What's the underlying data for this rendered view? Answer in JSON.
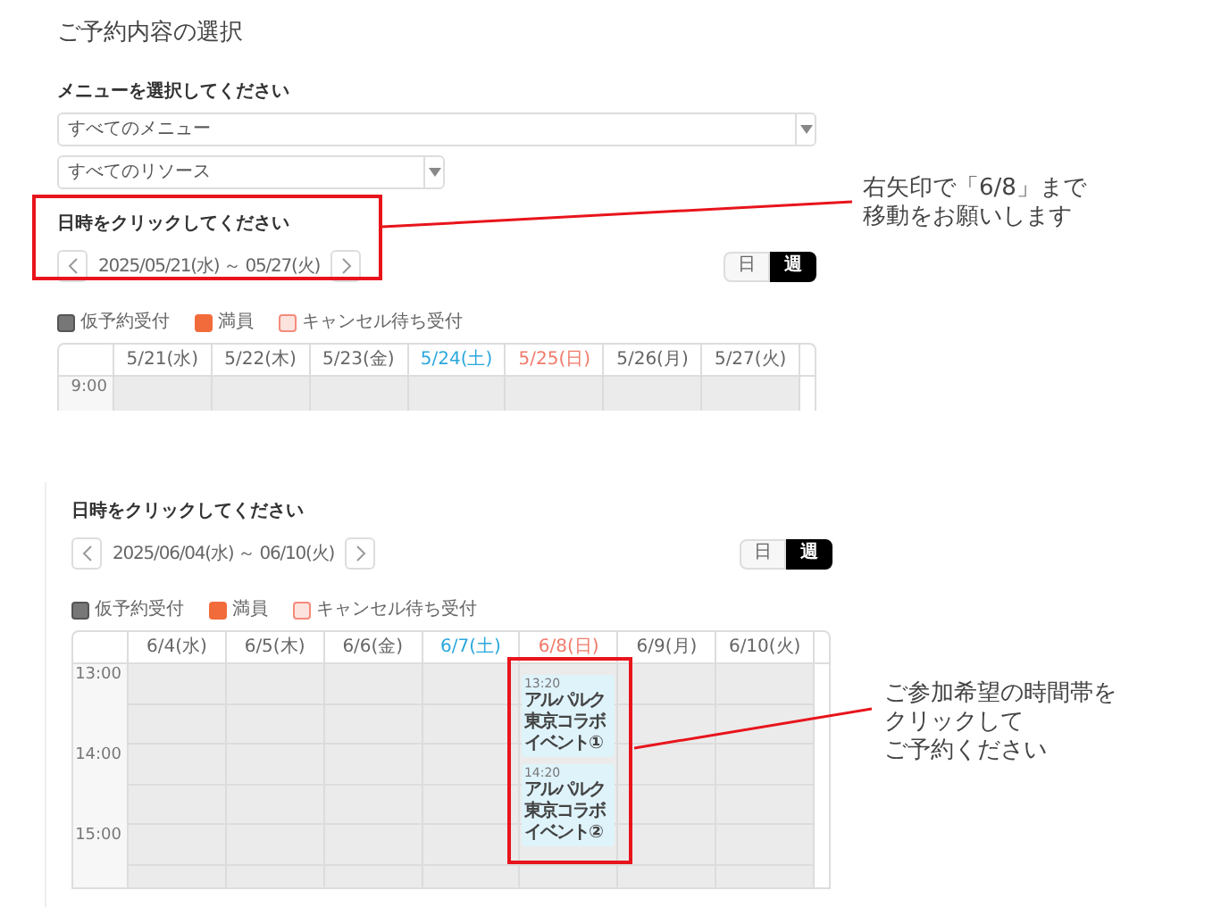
{
  "title": "ご予約内容の選択",
  "menu_select": {
    "label": "メニューを選択してください",
    "value": "すべてのメニュー"
  },
  "resource_select": {
    "value": "すべてのリソース"
  },
  "panels": [
    {
      "label": "日時をクリックしてください",
      "date_range": "2025/05/21(水) ～ 05/27(火)",
      "view_toggle": [
        {
          "label": "日",
          "selected": false
        },
        {
          "label": "週",
          "selected": true
        }
      ],
      "legend": [
        {
          "kind": "tentative",
          "label": "仮予約受付"
        },
        {
          "kind": "full",
          "label": "満員"
        },
        {
          "kind": "waitlist",
          "label": "キャンセル待ち受付"
        }
      ],
      "days": [
        {
          "label": "5/21(水)",
          "kind": "weekday"
        },
        {
          "label": "5/22(木)",
          "kind": "weekday"
        },
        {
          "label": "5/23(金)",
          "kind": "weekday"
        },
        {
          "label": "5/24(土)",
          "kind": "saturday"
        },
        {
          "label": "5/25(日)",
          "kind": "sunday"
        },
        {
          "label": "5/26(月)",
          "kind": "weekday"
        },
        {
          "label": "5/27(火)",
          "kind": "weekday"
        }
      ],
      "times": [
        "9:00"
      ]
    },
    {
      "label": "日時をクリックしてください",
      "date_range": "2025/06/04(水) ～ 06/10(火)",
      "view_toggle": [
        {
          "label": "日",
          "selected": false
        },
        {
          "label": "週",
          "selected": true
        }
      ],
      "legend": [
        {
          "kind": "tentative",
          "label": "仮予約受付"
        },
        {
          "kind": "full",
          "label": "満員"
        },
        {
          "kind": "waitlist",
          "label": "キャンセル待ち受付"
        }
      ],
      "days": [
        {
          "label": "6/4(水)",
          "kind": "weekday"
        },
        {
          "label": "6/5(木)",
          "kind": "weekday"
        },
        {
          "label": "6/6(金)",
          "kind": "weekday"
        },
        {
          "label": "6/7(土)",
          "kind": "saturday"
        },
        {
          "label": "6/8(日)",
          "kind": "sunday",
          "events": [
            {
              "time": "13:20",
              "title": "アルパルク東京コラボイベント①"
            },
            {
              "time": "14:20",
              "title": "アルパルク東京コラボイベント②"
            }
          ]
        },
        {
          "label": "6/9(月)",
          "kind": "weekday"
        },
        {
          "label": "6/10(火)",
          "kind": "weekday"
        }
      ],
      "times": [
        "13:00",
        "14:00",
        "15:00"
      ]
    }
  ],
  "callouts": [
    {
      "lines": [
        "右矢印で「6/8」まで",
        "移動をお願いします"
      ]
    },
    {
      "lines": [
        "ご参加希望の時間帯を",
        "クリックして",
        "ご予約ください"
      ]
    }
  ]
}
